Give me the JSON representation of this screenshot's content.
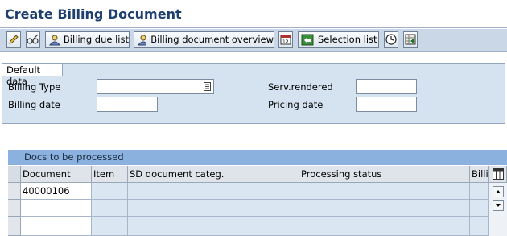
{
  "window": {
    "title": "Create Billing Document"
  },
  "toolbar": {
    "billing_due_list_label": "Billing due list",
    "billing_doc_overview_label": "Billing document overview",
    "selection_list_label": "Selection list"
  },
  "default_data": {
    "section_label": "Default data",
    "billing_type_label": "Billing Type",
    "billing_type_value": "",
    "billing_date_label": "Billing date",
    "billing_date_value": "",
    "serv_rendered_label": "Serv.rendered",
    "serv_rendered_value": "",
    "pricing_date_label": "Pricing date",
    "pricing_date_value": ""
  },
  "docs_table": {
    "title": "Docs to be processed",
    "columns": [
      "Document",
      "Item",
      "SD document categ.",
      "Processing status",
      "Billi"
    ],
    "rows": [
      [
        "40000106",
        "",
        "",
        "",
        ""
      ],
      [
        "",
        "",
        "",
        "",
        ""
      ],
      [
        "",
        "",
        "",
        "",
        ""
      ]
    ]
  },
  "colors": {
    "title_text": "#1f3f6f",
    "toolbar_bg": "#c9d7e6",
    "panel_bg": "#d5e3f1",
    "table_header_bar": "#8bb1de"
  }
}
